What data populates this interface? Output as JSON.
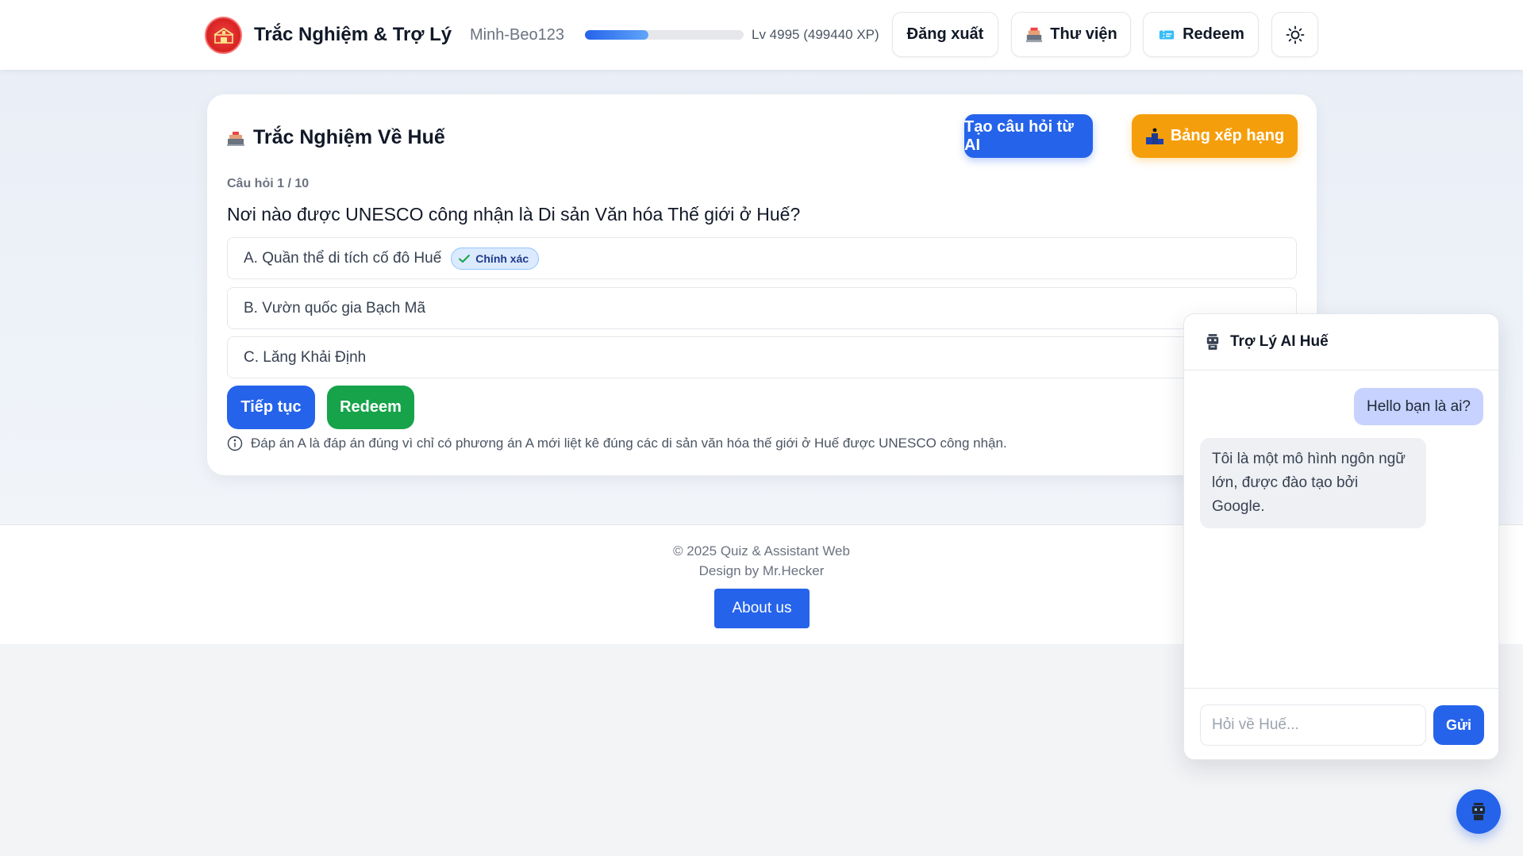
{
  "header": {
    "brand": "Trắc Nghiệm & Trợ Lý",
    "username": "Minh-Beo123",
    "xp_progress": 0.4,
    "level_text": "Lv 4995 (499440 XP)",
    "logout_label": "Đăng xuất",
    "library_label": "Thư viện",
    "redeem_label": "Redeem"
  },
  "quiz": {
    "title": "Trắc Nghiệm Về Huế",
    "ai_button": "Tạo câu hỏi từ AI",
    "rank_button": "Bảng xếp hạng",
    "question_number": "Câu hỏi 1 / 10",
    "question": "Nơi nào được UNESCO công nhận là Di sản Văn hóa Thế giới ở Huế?",
    "options": [
      {
        "label": "A. Quần thể di tích cố đô Huế",
        "correct": true
      },
      {
        "label": "B. Vườn quốc gia Bạch Mã",
        "correct": false
      },
      {
        "label": "C. Lăng Khải Định",
        "correct": false
      }
    ],
    "correct_badge": "Chính xác",
    "next_button": "Tiếp tục",
    "redeem_button": "Redeem",
    "explanation": "Đáp án A là đáp án đúng vì chỉ có phương án A mới liệt kê đúng các di sản văn hóa thế giới ở Huế được UNESCO công nhận."
  },
  "footer": {
    "copyright": "© 2025 Quiz & Assistant Web",
    "design": "Design by Mr.Hecker",
    "about_button": "About us"
  },
  "chat": {
    "title": "Trợ Lý AI Huế",
    "messages": [
      {
        "role": "user",
        "text": "Hello bạn là ai?"
      },
      {
        "role": "bot",
        "text": "Tôi là một mô hình ngôn ngữ lớn, được đào tạo bởi Google."
      }
    ],
    "input_placeholder": "Hỏi về Huế...",
    "send_button": "Gửi"
  },
  "colors": {
    "primary": "#2563eb",
    "success": "#16a34a",
    "warning": "#f59e0b",
    "logo": "#dc2626"
  }
}
